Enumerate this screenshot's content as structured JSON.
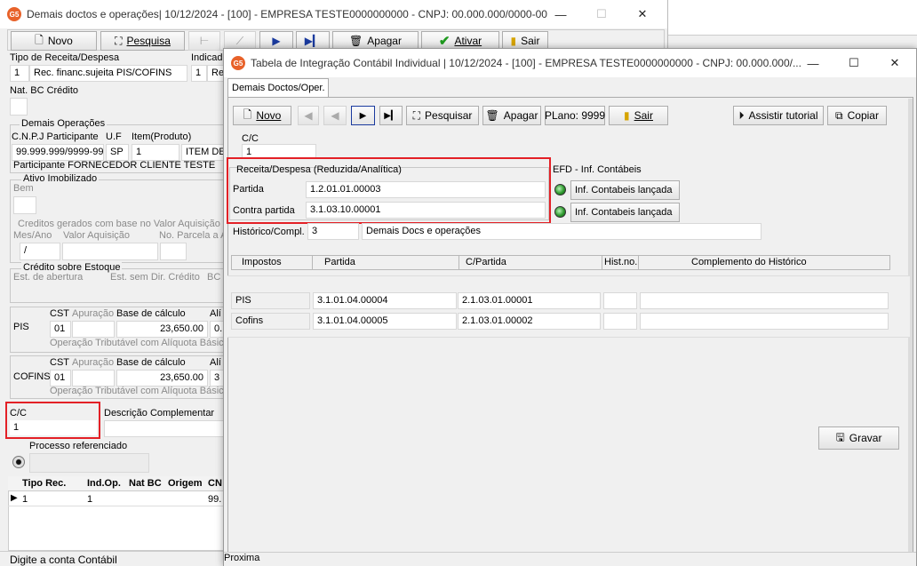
{
  "back_window": {
    "title": "Demais doctos e operações|  10/12/2024 - [100] - EMPRESA TESTE0000000000 - CNPJ: 00.000.000/0000-00",
    "toolbar": {
      "novo": "Novo",
      "pesquisa": "Pesquisa",
      "apagar": "Apagar",
      "ativar": "Ativar",
      "sair": "Sair"
    },
    "tipo_receita_label": "Tipo de Receita/Despesa",
    "tipo_receita_code": "1",
    "tipo_receita_desc": "Rec. financ.sujeita PIS/COFINS",
    "indicador_label": "Indicad",
    "indicador_code": "1",
    "indicador_desc": "Re",
    "nat_bc_label": "Nat. BC Crédito",
    "demais_operacoes_label": "Demais Operações",
    "cnpj_participante_label": "C.N.P.J Participante",
    "uf_label": "U.F",
    "item_label": "Item(Produto)",
    "cnpj_value": "99.999.999/9999-99",
    "uf_value": "SP",
    "item_code": "1",
    "item_desc": "ITEM DE",
    "participante_text": "Participante FORNECEDOR CLIENTE TESTE",
    "ativo_imobilizado_label": "Ativo Imobilizado",
    "bem_label": "Bem",
    "creditos_label": "Creditos gerados com base no Valor Aquisição",
    "mes_ano_label": "Mes/Ano",
    "valor_aquisicao_label": "Valor Aquisição",
    "no_parcela_label": "No. Parcela a A",
    "mes_ano_value": "/",
    "credito_estoque_label": "Crédito sobre Estoque",
    "est_abertura_label": "Est. de abertura",
    "est_sem_dir_label": "Est. sem Dir. Crédito",
    "bc_label": "BC",
    "pis_section": {
      "name": "PIS",
      "cst_label": "CST",
      "apuracao_label": "Apuração",
      "base_label": "Base de cálculo",
      "aliq_label": "Alí",
      "cst_value": "01",
      "base_value": "23,650.00",
      "aliq_value": "0.",
      "operacao_text": "Operação Tributável com Alíquota Básica"
    },
    "cofins_section": {
      "name": "COFINS",
      "cst_label": "CST",
      "apuracao_label": "Apuração",
      "base_label": "Base de cálculo",
      "aliq_label": "Alí",
      "cst_value": "01",
      "base_value": "23,650.00",
      "aliq_value": "3",
      "operacao_text": "Operação Tributável com Alíquota Básica"
    },
    "cc_label": "C/C",
    "cc_value": "1",
    "descricao_complementar_label": "Descrição Complementar",
    "processo_referenciado_label": "Processo referenciado",
    "grid": {
      "headers": [
        "Tipo Rec.",
        "Ind.Op.",
        "Nat BC",
        "Origem",
        "CN"
      ],
      "row": [
        "1",
        "1",
        "",
        "",
        "99."
      ]
    },
    "status_text": "Digite a conta Contábil"
  },
  "front_window": {
    "title": "Tabela de Integração Contábil Individual  |  10/12/2024 - [100] - EMPRESA TESTE0000000000 - CNPJ: 00.000.000/...",
    "tab_label": "Demais Doctos/Oper.",
    "toolbar": {
      "novo": "Novo",
      "pesquisar": "Pesquisar",
      "apagar": "Apagar",
      "plano": "PLano: 9999",
      "sair": "Sair",
      "assistir": "Assistir tutorial",
      "copiar": "Copiar"
    },
    "cc_label": "C/C",
    "cc_value": "1",
    "receita_group_label": "Receita/Despesa (Reduzida/Analítica)",
    "partida_label": "Partida",
    "partida_value": "1.2.01.01.00003",
    "contra_partida_label": "Contra partida",
    "contra_partida_value": "3.1.03.10.00001",
    "efd_label": "EFD - Inf. Contábeis",
    "efd_status_1": "Inf. Contabeis lançada",
    "efd_status_2": "Inf. Contabeis lançada",
    "historico_label": "Histórico/Compl.",
    "historico_code": "3",
    "historico_desc": "Demais Docs e operações",
    "impostos_headers": {
      "impostos": "Impostos",
      "partida": "Partida",
      "c_partida": "C/Partida",
      "hist_no": "Hist.no.",
      "complemento": "Complemento do Histórico"
    },
    "impostos_rows": [
      {
        "imposto": "PIS",
        "partida": "3.1.01.04.00004",
        "c_partida": "2.1.03.01.00001",
        "hist": "",
        "complemento": ""
      },
      {
        "imposto": "Cofins",
        "partida": "3.1.01.04.00005",
        "c_partida": "2.1.03.01.00002",
        "hist": "",
        "complemento": ""
      }
    ],
    "gravar_label": "Gravar",
    "status_text": "Proxima"
  },
  "icons": [
    "app-logo-icon",
    "new-doc-icon",
    "binoculars-icon",
    "trash-icon",
    "checkmark-icon",
    "exit-door-icon",
    "play-icon",
    "last-icon",
    "first-icon",
    "prev-icon",
    "copy-icon",
    "save-icon",
    "led-green-icon",
    "radio-icon",
    "row-pointer-icon"
  ],
  "colors": {
    "highlight_box": "#e32026",
    "app_icon": "#e8622a",
    "led_green": "#2e9a2e"
  }
}
